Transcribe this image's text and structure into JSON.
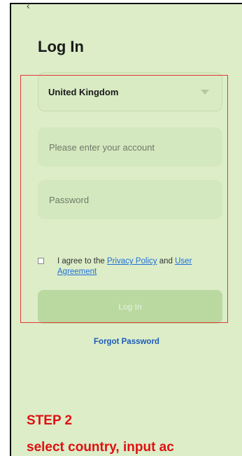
{
  "screen": {
    "title": "Log In"
  },
  "form": {
    "country_value": "United Kingdom",
    "account_placeholder": "Please enter your account",
    "password_placeholder": "Password",
    "agreement": {
      "prefix": "I agree to the ",
      "privacy_link": "Privacy Policy",
      "and": " and ",
      "user_link_part1": "User",
      "user_link_part2": "Agreement"
    },
    "login_label": "Log In",
    "forgot_label": "Forgot Password"
  },
  "annotation": {
    "step_title": "STEP 2",
    "step_desc": "select country, input ac",
    "highlight_color": "#e53935"
  },
  "icons": {
    "dropdown": "chevron-down-icon",
    "checkbox": "checkbox-icon"
  }
}
